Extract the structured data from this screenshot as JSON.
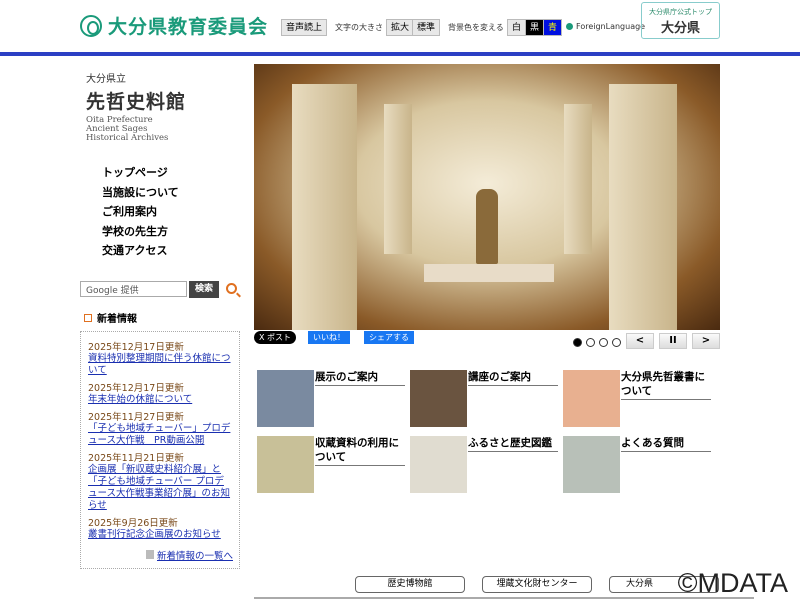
{
  "header": {
    "logo": "大分県教育委員会",
    "speech": "音声読上",
    "font_size_label": "文字の大きさ",
    "enlarge": "拡大",
    "standard": "標準",
    "bg_label": "背景色を変える",
    "bg_white": "白",
    "bg_black": "黒",
    "bg_blue": "青",
    "foreign": "ForeignLanguage",
    "pref_top_label": "大分県庁公式トップ",
    "pref_top_logo": "大分県"
  },
  "site": {
    "line1": "大分県立",
    "name": "先哲史料館",
    "en1": "Oita Prefecture",
    "en2": "Ancient Sages",
    "en3": "Historical Archives"
  },
  "nav": [
    "トップページ",
    "当施設について",
    "ご利用案内",
    "学校の先生方",
    "交通アクセス"
  ],
  "search": {
    "placeholder": "Google 提供",
    "button": "検索"
  },
  "news": {
    "title": "新着情報",
    "items": [
      {
        "date": "2025年12月17日更新",
        "text": "資料特別整理期間に伴う休館について"
      },
      {
        "date": "2025年12月17日更新",
        "text": "年末年始の休館について"
      },
      {
        "date": "2025年11月27日更新",
        "text": "「子ども地域チューバー」プロデュース大作戦　PR動画公開"
      },
      {
        "date": "2025年11月21日更新",
        "text": "企画展「新収蔵史料紹介展」と「子ども地域チューバー プロデュース大作戦事業紹介展」のお知らせ"
      },
      {
        "date": "2025年9月26日更新",
        "text": "叢書刊行記念企画展のお知らせ"
      }
    ],
    "more": "新着情報の一覧へ"
  },
  "share": {
    "x": "X ポスト",
    "like": "いいね！",
    "fb_share": "シェアする"
  },
  "slider": {
    "current": 1,
    "total": 4,
    "prev": "<",
    "pause": "II",
    "next": ">"
  },
  "cards": [
    {
      "label": "展示のご案内",
      "color": "#7a8aa0"
    },
    {
      "label": "講座のご案内",
      "color": "#6a5440"
    },
    {
      "label": "大分県先哲叢書について",
      "color": "#e8b090"
    },
    {
      "label": "収蔵資料の利用について",
      "color": "#c8c098"
    },
    {
      "label": "ふるさと歴史図鑑",
      "color": "#e0dcd0"
    },
    {
      "label": "よくある質問",
      "color": "#b8c0b8"
    }
  ],
  "footer": {
    "links": [
      "歴史博物館",
      "埋蔵文化財センター",
      "大分県"
    ],
    "watermark": "©MDATA"
  }
}
